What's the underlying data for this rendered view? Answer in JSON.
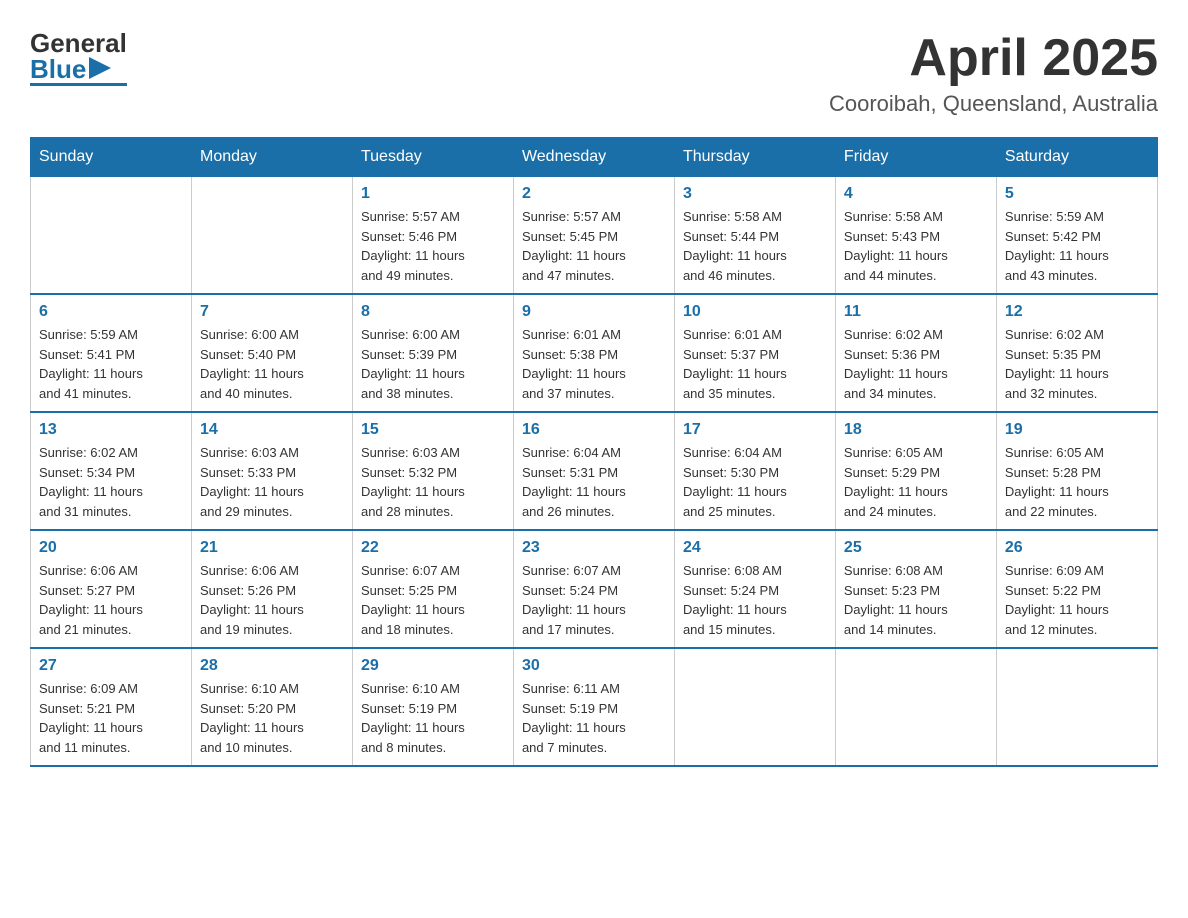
{
  "header": {
    "logo": {
      "line1": "General",
      "line2": "Blue"
    },
    "month": "April 2025",
    "location": "Cooroibah, Queensland, Australia"
  },
  "weekdays": [
    "Sunday",
    "Monday",
    "Tuesday",
    "Wednesday",
    "Thursday",
    "Friday",
    "Saturday"
  ],
  "weeks": [
    [
      {
        "day": "",
        "info": ""
      },
      {
        "day": "",
        "info": ""
      },
      {
        "day": "1",
        "info": "Sunrise: 5:57 AM\nSunset: 5:46 PM\nDaylight: 11 hours\nand 49 minutes."
      },
      {
        "day": "2",
        "info": "Sunrise: 5:57 AM\nSunset: 5:45 PM\nDaylight: 11 hours\nand 47 minutes."
      },
      {
        "day": "3",
        "info": "Sunrise: 5:58 AM\nSunset: 5:44 PM\nDaylight: 11 hours\nand 46 minutes."
      },
      {
        "day": "4",
        "info": "Sunrise: 5:58 AM\nSunset: 5:43 PM\nDaylight: 11 hours\nand 44 minutes."
      },
      {
        "day": "5",
        "info": "Sunrise: 5:59 AM\nSunset: 5:42 PM\nDaylight: 11 hours\nand 43 minutes."
      }
    ],
    [
      {
        "day": "6",
        "info": "Sunrise: 5:59 AM\nSunset: 5:41 PM\nDaylight: 11 hours\nand 41 minutes."
      },
      {
        "day": "7",
        "info": "Sunrise: 6:00 AM\nSunset: 5:40 PM\nDaylight: 11 hours\nand 40 minutes."
      },
      {
        "day": "8",
        "info": "Sunrise: 6:00 AM\nSunset: 5:39 PM\nDaylight: 11 hours\nand 38 minutes."
      },
      {
        "day": "9",
        "info": "Sunrise: 6:01 AM\nSunset: 5:38 PM\nDaylight: 11 hours\nand 37 minutes."
      },
      {
        "day": "10",
        "info": "Sunrise: 6:01 AM\nSunset: 5:37 PM\nDaylight: 11 hours\nand 35 minutes."
      },
      {
        "day": "11",
        "info": "Sunrise: 6:02 AM\nSunset: 5:36 PM\nDaylight: 11 hours\nand 34 minutes."
      },
      {
        "day": "12",
        "info": "Sunrise: 6:02 AM\nSunset: 5:35 PM\nDaylight: 11 hours\nand 32 minutes."
      }
    ],
    [
      {
        "day": "13",
        "info": "Sunrise: 6:02 AM\nSunset: 5:34 PM\nDaylight: 11 hours\nand 31 minutes."
      },
      {
        "day": "14",
        "info": "Sunrise: 6:03 AM\nSunset: 5:33 PM\nDaylight: 11 hours\nand 29 minutes."
      },
      {
        "day": "15",
        "info": "Sunrise: 6:03 AM\nSunset: 5:32 PM\nDaylight: 11 hours\nand 28 minutes."
      },
      {
        "day": "16",
        "info": "Sunrise: 6:04 AM\nSunset: 5:31 PM\nDaylight: 11 hours\nand 26 minutes."
      },
      {
        "day": "17",
        "info": "Sunrise: 6:04 AM\nSunset: 5:30 PM\nDaylight: 11 hours\nand 25 minutes."
      },
      {
        "day": "18",
        "info": "Sunrise: 6:05 AM\nSunset: 5:29 PM\nDaylight: 11 hours\nand 24 minutes."
      },
      {
        "day": "19",
        "info": "Sunrise: 6:05 AM\nSunset: 5:28 PM\nDaylight: 11 hours\nand 22 minutes."
      }
    ],
    [
      {
        "day": "20",
        "info": "Sunrise: 6:06 AM\nSunset: 5:27 PM\nDaylight: 11 hours\nand 21 minutes."
      },
      {
        "day": "21",
        "info": "Sunrise: 6:06 AM\nSunset: 5:26 PM\nDaylight: 11 hours\nand 19 minutes."
      },
      {
        "day": "22",
        "info": "Sunrise: 6:07 AM\nSunset: 5:25 PM\nDaylight: 11 hours\nand 18 minutes."
      },
      {
        "day": "23",
        "info": "Sunrise: 6:07 AM\nSunset: 5:24 PM\nDaylight: 11 hours\nand 17 minutes."
      },
      {
        "day": "24",
        "info": "Sunrise: 6:08 AM\nSunset: 5:24 PM\nDaylight: 11 hours\nand 15 minutes."
      },
      {
        "day": "25",
        "info": "Sunrise: 6:08 AM\nSunset: 5:23 PM\nDaylight: 11 hours\nand 14 minutes."
      },
      {
        "day": "26",
        "info": "Sunrise: 6:09 AM\nSunset: 5:22 PM\nDaylight: 11 hours\nand 12 minutes."
      }
    ],
    [
      {
        "day": "27",
        "info": "Sunrise: 6:09 AM\nSunset: 5:21 PM\nDaylight: 11 hours\nand 11 minutes."
      },
      {
        "day": "28",
        "info": "Sunrise: 6:10 AM\nSunset: 5:20 PM\nDaylight: 11 hours\nand 10 minutes."
      },
      {
        "day": "29",
        "info": "Sunrise: 6:10 AM\nSunset: 5:19 PM\nDaylight: 11 hours\nand 8 minutes."
      },
      {
        "day": "30",
        "info": "Sunrise: 6:11 AM\nSunset: 5:19 PM\nDaylight: 11 hours\nand 7 minutes."
      },
      {
        "day": "",
        "info": ""
      },
      {
        "day": "",
        "info": ""
      },
      {
        "day": "",
        "info": ""
      }
    ]
  ]
}
